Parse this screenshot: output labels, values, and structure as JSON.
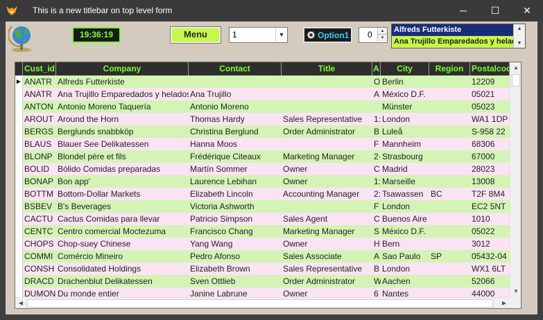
{
  "window": {
    "title": "This is a new titlebar on top level form",
    "app_icon": "fox-icon",
    "minimize_glyph": "─",
    "maximize_glyph": "☐",
    "close_glyph": "✕"
  },
  "toolbar": {
    "globe_icon": "globe-icon",
    "clock": "19:36:19",
    "menu_label": "Menu",
    "combo_value": "1",
    "option_label": "Option1",
    "spinner_value": "0",
    "listbox_items": [
      "Alfreds Futterkiste",
      "Ana Trujillo Emparedados y helados"
    ]
  },
  "colors": {
    "accent_green": "#7cff2c",
    "button_green": "#c6f74a",
    "row_green": "#d3f4b4",
    "row_pink": "#fbe3f3",
    "option_blue": "#34d1ff",
    "header_bg": "#2e2e2e"
  },
  "grid": {
    "columns": [
      "Cust_id",
      "Company",
      "Contact",
      "Title",
      "A",
      "City",
      "Region",
      "Postalcod"
    ],
    "rows": [
      [
        "ANATR",
        "Alfreds Futterkiste",
        "",
        "",
        "O",
        "Berlin",
        "",
        "12209"
      ],
      [
        "ANATR",
        "Ana Trujillo Emparedados y helados",
        "Ana Trujillo",
        "",
        "A",
        "México D.F.",
        "",
        "05021"
      ],
      [
        "ANTON",
        "Antonio Moreno Taquería",
        "Antonio Moreno",
        "",
        "",
        "Münster",
        "",
        "05023"
      ],
      [
        "AROUT",
        "Around the Horn",
        "Thomas Hardy",
        "Sales Representative",
        "1:",
        "London",
        "",
        "WA1 1DP"
      ],
      [
        "BERGS",
        "Berglunds snabbköp",
        "Christina Berglund",
        "Order Administrator",
        "B",
        "Luleå",
        "",
        "S-958 22"
      ],
      [
        "BLAUS",
        "Blauer See Delikatessen",
        "Hanna Moos",
        "",
        "F",
        "Mannheim",
        "",
        "68306"
      ],
      [
        "BLONP",
        "Blondel père et fils",
        "Frédérique Citeaux",
        "Marketing Manager",
        "2·",
        "Strasbourg",
        "",
        "67000"
      ],
      [
        "BOLID",
        "Bólido Comidas preparadas",
        "Martín Sommer",
        "Owner",
        "C",
        "Madrid",
        "",
        "28023"
      ],
      [
        "BONAP",
        "Bon app'",
        "Laurence Lebihan",
        "Owner",
        "1:",
        "Marseille",
        "",
        "13008"
      ],
      [
        "BOTTM",
        "Bottom-Dollar Markets",
        "Elizabeth Lincoln",
        "Accounting Manager",
        "2:",
        "Tsawassen",
        "BC",
        "T2F 8M4"
      ],
      [
        "BSBEV",
        "B's Beverages",
        "Victoria Ashworth",
        "",
        "F",
        "London",
        "",
        "EC2 5NT"
      ],
      [
        "CACTU",
        "Cactus Comidas para llevar",
        "Patricio Simpson",
        "Sales Agent",
        "C",
        "Buenos Aire",
        "",
        "1010"
      ],
      [
        "CENTC",
        "Centro comercial Moctezuma",
        "Francisco Chang",
        "Marketing Manager",
        "S",
        "México D.F.",
        "",
        "05022"
      ],
      [
        "CHOPS",
        "Chop-suey Chinese",
        "Yang Wang",
        "Owner",
        "H",
        "Bern",
        "",
        "3012"
      ],
      [
        "COMMI",
        "Comércio Mineiro",
        "Pedro Afonso",
        "Sales Associate",
        "A",
        "Sao Paulo",
        "SP",
        "05432-04"
      ],
      [
        "CONSH",
        "Consolidated Holdings",
        "Elizabeth Brown",
        "Sales Representative",
        "B",
        "London",
        "",
        "WX1 6LT"
      ],
      [
        "DRACD",
        "Drachenblut Delikatessen",
        "Sven Ottlieb",
        "Order Administrator",
        "W",
        "Aachen",
        "",
        "52066"
      ],
      [
        "DUMON",
        "Du monde entier",
        "Janine Labrune",
        "Owner",
        "6",
        "Nantes",
        "",
        "44000"
      ]
    ]
  }
}
